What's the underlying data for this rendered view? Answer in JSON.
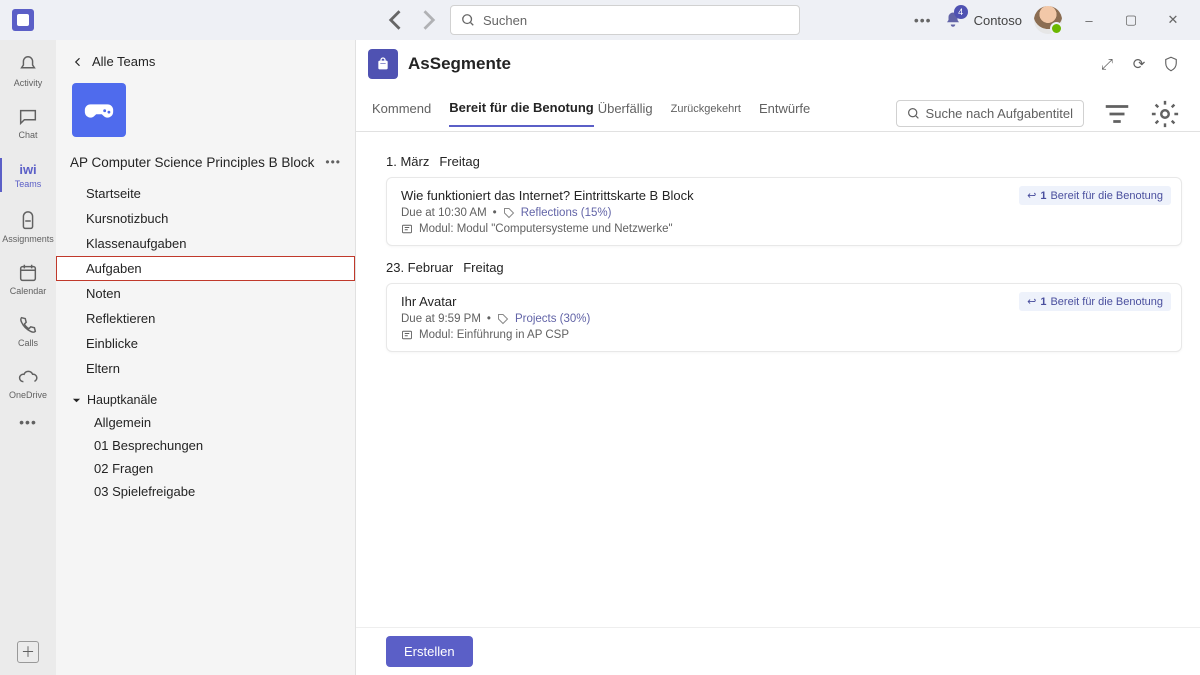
{
  "titlebar": {
    "search_placeholder": "Suchen",
    "notification_count": "4",
    "org_name": "Contoso"
  },
  "rail": [
    {
      "id": "activity",
      "label": "Activity"
    },
    {
      "id": "chat",
      "label": "Chat"
    },
    {
      "id": "teams",
      "label": "iwi",
      "sublabel": "Teams",
      "selected": true
    },
    {
      "id": "assignments",
      "label": "Assignments"
    },
    {
      "id": "calendar",
      "label": "Calendar"
    },
    {
      "id": "calls",
      "label": "Calls"
    },
    {
      "id": "onedrive",
      "label": "OneDrive"
    }
  ],
  "team_panel": {
    "back_label": "Alle Teams",
    "team_name": "AP Computer Science Principles B Block",
    "menu": [
      {
        "id": "home",
        "label": "Startseite"
      },
      {
        "id": "classnotebook",
        "label": "Kursnotizbuch"
      },
      {
        "id": "classwork",
        "label": "Klassenaufgaben"
      },
      {
        "id": "assignments",
        "label": "Aufgaben",
        "selected": true
      },
      {
        "id": "grades",
        "label": "Noten"
      },
      {
        "id": "reflect",
        "label": "Reflektieren"
      },
      {
        "id": "insights",
        "label": "Einblicke"
      },
      {
        "id": "parents",
        "label": "Eltern"
      }
    ],
    "section_label": "Hauptkanäle",
    "channels": [
      {
        "label": "Allgemein"
      },
      {
        "label": "01 Besprechungen"
      },
      {
        "label": "02 Fragen"
      },
      {
        "label": "03 Spielefreigabe"
      }
    ]
  },
  "main": {
    "app_title": "AsSegmente",
    "tabs": [
      {
        "label": "Kommend"
      },
      {
        "label": "Bereit für die Benotung",
        "selected": true
      },
      {
        "label": "Überfällig"
      },
      {
        "label": "Zurückgekehrt"
      },
      {
        "label": "Entwürfe"
      }
    ],
    "search_placeholder": "Suche nach Aufgabentitel",
    "groups": [
      {
        "date": "1. März",
        "day": "Freitag",
        "card": {
          "title": "Wie funktioniert das Internet? Eintrittskarte B Block",
          "due": "Due at 10:30 AM",
          "tag": "Reflections (15%)",
          "module": "Modul: Modul \"Computersysteme und Netzwerke\"",
          "status_count": "1",
          "status_label": "Bereit für die Benotung"
        }
      },
      {
        "date": "23. Februar",
        "day": "Freitag",
        "card": {
          "title": "Ihr Avatar",
          "due": "Due at 9:59 PM",
          "tag": "Projects (30%)",
          "module": "Modul: Einführung in AP CSP",
          "status_count": "1",
          "status_label": "Bereit für die Benotung"
        }
      }
    ],
    "create_label": "Erstellen"
  }
}
